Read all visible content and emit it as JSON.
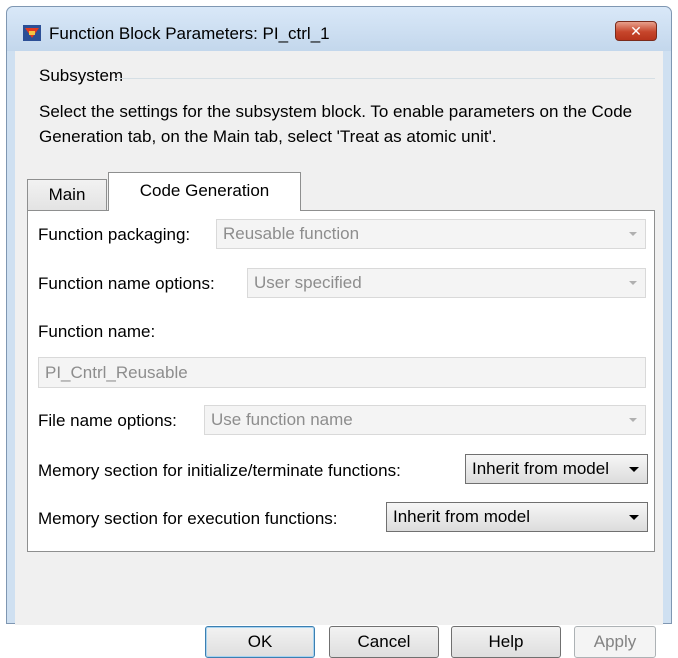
{
  "window": {
    "title": "Function Block Parameters: PI_ctrl_1",
    "close_glyph": "✕"
  },
  "group": {
    "label": "Subsystem",
    "description": "Select the settings for the subsystem block. To enable parameters on the Code Generation tab, on the Main tab, select 'Treat as atomic unit'."
  },
  "tabs": [
    {
      "label": "Main",
      "active": false
    },
    {
      "label": "Code Generation",
      "active": true
    }
  ],
  "form": {
    "function_packaging": {
      "label": "Function packaging:",
      "value": "Reusable function",
      "enabled": false
    },
    "function_name_options": {
      "label": "Function name options:",
      "value": "User specified",
      "enabled": false
    },
    "function_name": {
      "label": "Function name:",
      "value": "PI_Cntrl_Reusable",
      "enabled": false
    },
    "file_name_options": {
      "label": "File name options:",
      "value": "Use function name",
      "enabled": false
    },
    "memory_init_term": {
      "label": "Memory section for initialize/terminate functions:",
      "value": "Inherit from model",
      "enabled": true
    },
    "memory_exec": {
      "label": "Memory section for execution functions:",
      "value": "Inherit from model",
      "enabled": true
    }
  },
  "buttons": {
    "ok": "OK",
    "cancel": "Cancel",
    "help": "Help",
    "apply": "Apply"
  },
  "colors": {
    "title_bar": "#c3d7ec",
    "close_button": "#c6452b",
    "dialog_bg": "#f0f0f0",
    "panel_bg": "#ffffff"
  }
}
